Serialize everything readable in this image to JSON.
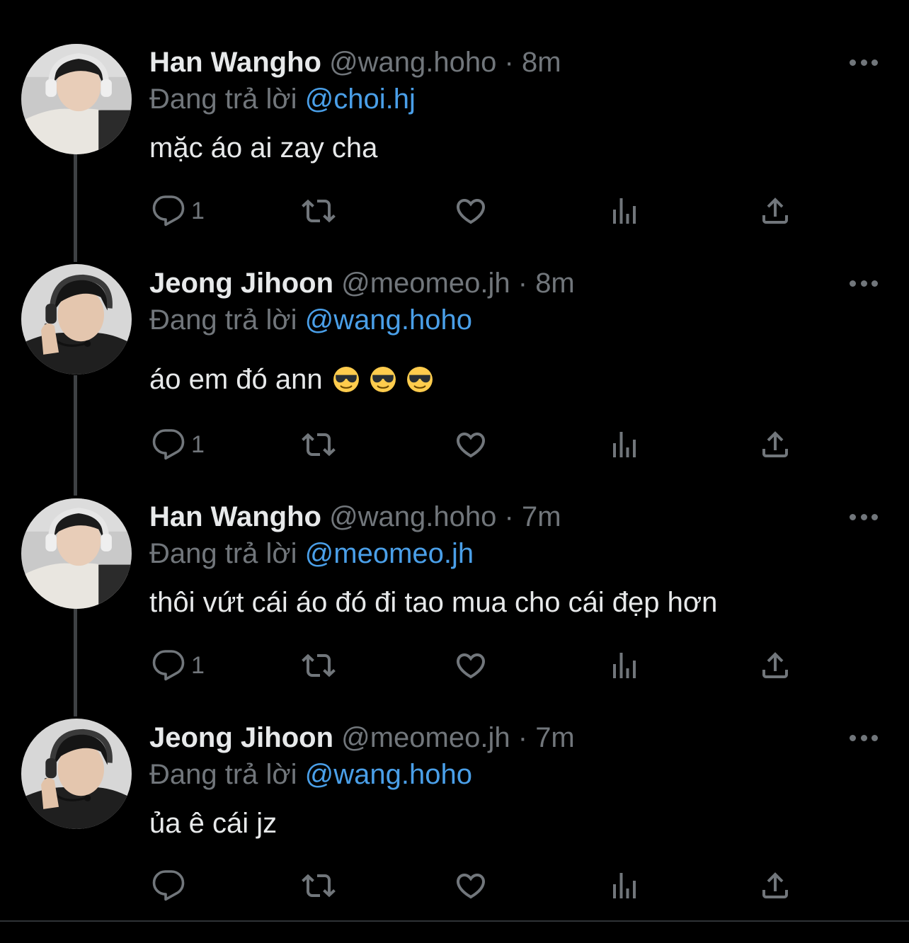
{
  "tweets": [
    {
      "name": "Han Wangho",
      "handle": "@wang.hoho",
      "dot": "·",
      "time": "8m",
      "reply_prefix": "Đang trả lời",
      "reply_to": "@choi.hj",
      "text": "mặc áo ai zay cha",
      "emoji": [],
      "reply_count": "1",
      "avatar": "han-wangho-avatar"
    },
    {
      "name": "Jeong Jihoon",
      "handle": "@meomeo.jh",
      "dot": "·",
      "time": "8m",
      "reply_prefix": "Đang trả lời",
      "reply_to": "@wang.hoho",
      "text": "áo em đó ann",
      "emoji": [
        "smiling-face-with-sunglasses",
        "smiling-face-with-sunglasses",
        "smiling-face-with-sunglasses"
      ],
      "reply_count": "1",
      "avatar": "jeong-jihoon-avatar"
    },
    {
      "name": "Han Wangho",
      "handle": "@wang.hoho",
      "dot": "·",
      "time": "7m",
      "reply_prefix": "Đang trả lời",
      "reply_to": "@meomeo.jh",
      "text": "thôi vứt cái áo đó đi tao mua cho cái đẹp hơn",
      "emoji": [],
      "reply_count": "1",
      "avatar": "han-wangho-avatar"
    },
    {
      "name": "Jeong Jihoon",
      "handle": "@meomeo.jh",
      "dot": "·",
      "time": "7m",
      "reply_prefix": "Đang trả lời",
      "reply_to": "@wang.hoho",
      "text": "ủa ê cái jz",
      "emoji": [],
      "reply_count": "",
      "avatar": "jeong-jihoon-avatar"
    }
  ],
  "colors": {
    "background": "#000000",
    "text": "#e7e9ea",
    "muted": "#71767b",
    "mention": "#4a9fe8",
    "thread_line": "#3e4144"
  },
  "icons": [
    "reply-icon",
    "retweet-icon",
    "like-icon",
    "views-icon",
    "share-icon",
    "more-icon"
  ]
}
